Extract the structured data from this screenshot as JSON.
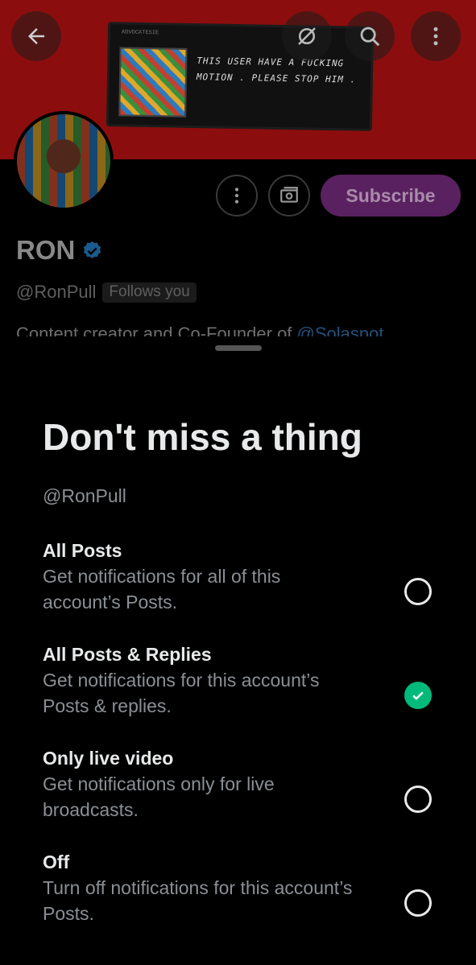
{
  "banner": {
    "art_small_text": "ADVOCATESIE",
    "art_caption": "THIS USER HAVE A FUCKING MOTION . PLEASE STOP HIM ."
  },
  "profile": {
    "name": "RON",
    "handle": "@RonPull",
    "follows_badge": "Follows you",
    "bio_text": "Content creator and Co-Founder of ",
    "bio_mention": "@Solaspot",
    "subscribe_label": "Subscribe"
  },
  "sheet": {
    "title": "Don't miss a thing",
    "handle": "@RonPull",
    "options": [
      {
        "title": "All Posts",
        "line1": "Get notifications for all of this",
        "line2": "account’s Posts.",
        "selected": false
      },
      {
        "title": "All Posts & Replies",
        "line1": "Get notifications for this account’s",
        "line2": "Posts & replies.",
        "selected": true
      },
      {
        "title": "Only live video",
        "line1": "Get notifications only for live",
        "line2": "broadcasts.",
        "selected": false
      },
      {
        "title": "Off",
        "line1": "Turn off notifications for this account’s",
        "line2": "Posts.",
        "selected": false
      }
    ]
  },
  "icons": {
    "back": "arrow-left-icon",
    "grok": "grok-icon",
    "search": "search-icon",
    "more": "more-vertical-icon",
    "profile_more": "more-vertical-icon",
    "tip": "money-icon",
    "verified": "verified-badge-icon",
    "check": "check-icon"
  },
  "colors": {
    "accent_green": "#00ba7c",
    "subscribe_purple": "#5a2160",
    "banner_red": "#8c0d0d",
    "verified_blue": "#1d9bf0"
  }
}
